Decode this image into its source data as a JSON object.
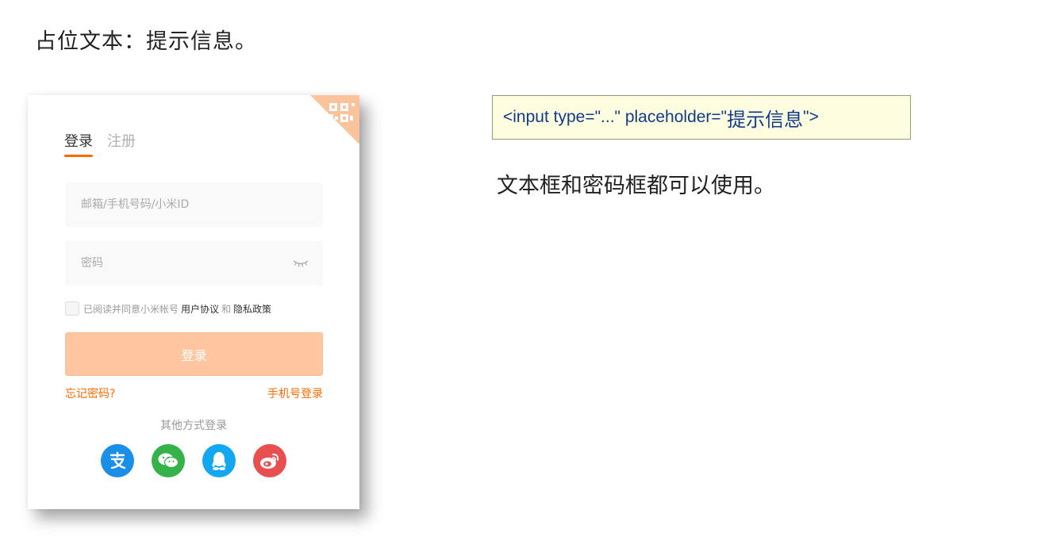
{
  "slide": {
    "title": "占位文本：提示信息。",
    "code_prefix": "<input type=\"...\" placeholder=\"",
    "code_value": "提示信息",
    "code_suffix": "\">",
    "description": "文本框和密码框都可以使用。"
  },
  "login_card": {
    "tabs": [
      {
        "label": "登录",
        "active": true
      },
      {
        "label": "注册",
        "active": false
      }
    ],
    "account_placeholder": "邮箱/手机号码/小米ID",
    "password_placeholder": "密码",
    "agreement": {
      "text": "已阅读并同意小米帐号",
      "user_agreement": "用户协议",
      "and": "和",
      "privacy_policy": "隐私政策"
    },
    "login_button": "登录",
    "forgot_password": "忘记密码?",
    "phone_login": "手机号登录",
    "other_login_title": "其他方式登录",
    "social_icons": [
      "alipay-icon",
      "wechat-icon",
      "qq-icon",
      "weibo-icon"
    ],
    "colors": {
      "accent": "#ff6a00",
      "button_bg": "#ffc6a0",
      "alipay": "#1b8fe8",
      "wechat": "#36b24a",
      "qq": "#12a7f0",
      "weibo": "#e8504f"
    }
  }
}
